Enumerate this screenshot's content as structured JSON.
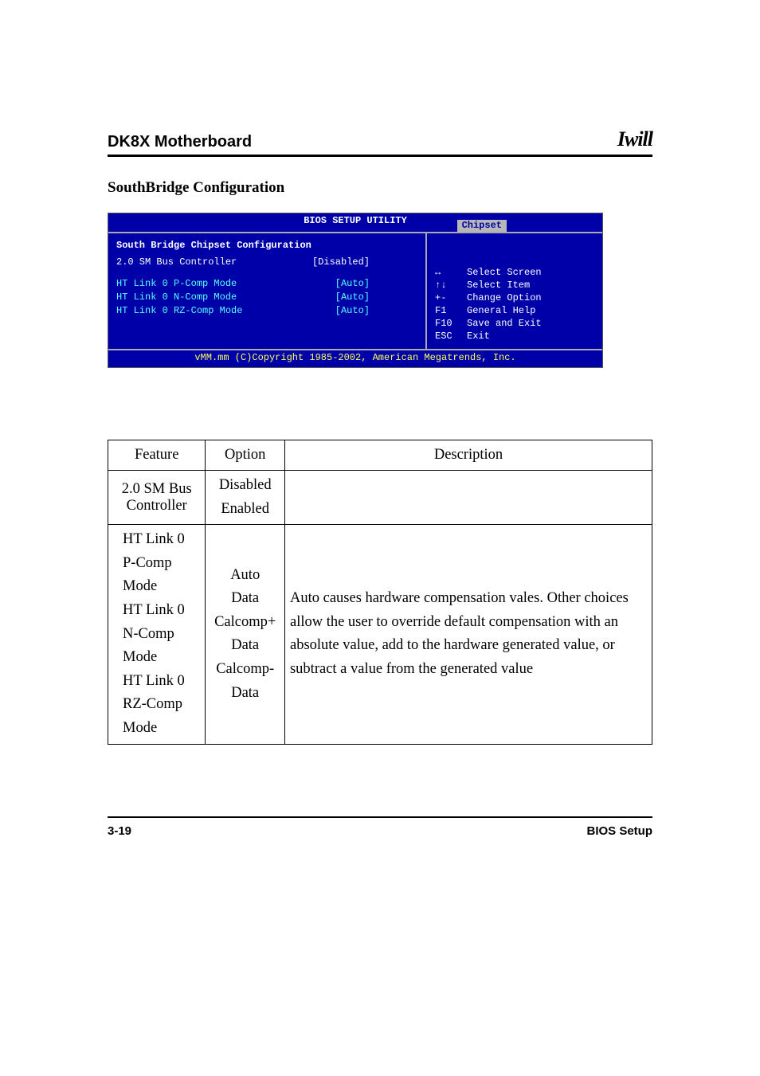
{
  "header": {
    "product": "DK8X Motherboard",
    "brand": "Iwill"
  },
  "section_title": "SouthBridge Configuration",
  "bios": {
    "title": "BIOS SETUP UTILITY",
    "tab": "Chipset",
    "section": "South Bridge Chipset Configuration",
    "items": [
      {
        "name": "2.0 SM Bus Controller",
        "value": "[Disabled]",
        "selected": true
      },
      {
        "name": "HT Link 0 P-Comp Mode",
        "value": "[Auto]",
        "selected": false
      },
      {
        "name": "HT Link 0 N-Comp Mode",
        "value": "[Auto]",
        "selected": false
      },
      {
        "name": "HT Link 0 RZ-Comp Mode",
        "value": "[Auto]",
        "selected": false
      }
    ],
    "help": [
      {
        "key": "↔",
        "label": "Select Screen"
      },
      {
        "key": "↑↓",
        "label": "Select Item"
      },
      {
        "key": "+-",
        "label": "Change Option"
      },
      {
        "key": "F1",
        "label": "General Help"
      },
      {
        "key": "F10",
        "label": "Save and Exit"
      },
      {
        "key": "ESC",
        "label": "Exit"
      }
    ],
    "footer": "vMM.mm (C)Copyright 1985-2002, American Megatrends, Inc."
  },
  "table": {
    "headers": {
      "feature": "Feature",
      "option": "Option",
      "description": "Description"
    },
    "rows": [
      {
        "feature": "2.0 SM Bus Controller",
        "option": "Disabled\nEnabled",
        "description": ""
      },
      {
        "feature": "HT Link 0 P-Comp Mode\nHT Link 0 N-Comp Mode\nHT Link 0 RZ-Comp Mode",
        "option": "Auto\nData\nCalcomp+ Data\nCalcomp- Data",
        "description": "Auto causes hardware compensation vales. Other choices allow the user to override default compensation with an absolute value, add to the hardware generated value, or subtract a value from the generated value"
      }
    ]
  },
  "footer": {
    "page": "3-19",
    "section": "BIOS Setup"
  }
}
